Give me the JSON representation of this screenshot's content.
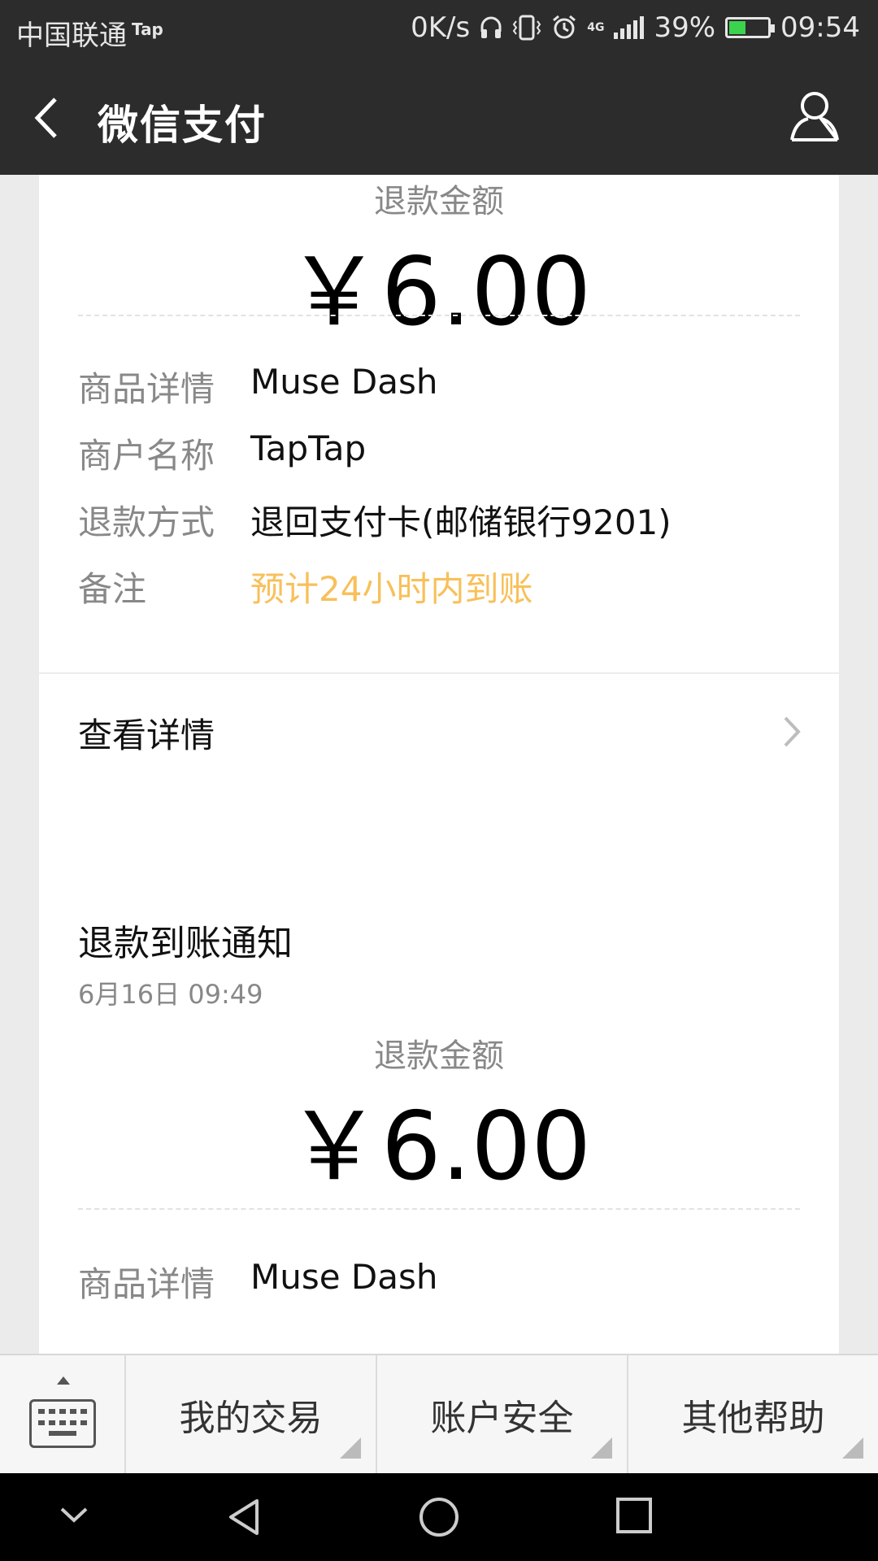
{
  "status_bar": {
    "carrier": "中国联通",
    "carrier_badge": "Tap",
    "speed": "0K/s",
    "network": "4G",
    "battery": "39%",
    "time": "09:54"
  },
  "title_bar": {
    "title": "微信支付",
    "back_icon": "chevron-left-icon",
    "user_icon": "user-icon"
  },
  "refund_card": {
    "amount_label": "退款金额",
    "amount": "￥6.00",
    "rows": [
      {
        "key": "商品详情",
        "value": "Muse Dash"
      },
      {
        "key": "商户名称",
        "value": "TapTap"
      },
      {
        "key": "退款方式",
        "value": "退回支付卡(邮储银行9201)"
      },
      {
        "key": "备注",
        "value": "预计24小时内到账"
      }
    ],
    "details_label": "查看详情"
  },
  "notice_card": {
    "title": "退款到账通知",
    "time": "6月16日  09:49",
    "amount_label": "退款金额",
    "amount": "￥6.00",
    "partial_row": {
      "key": "商品详情",
      "value": "Muse Dash"
    }
  },
  "bottom_menu": {
    "items": [
      "我的交易",
      "账户安全",
      "其他帮助"
    ]
  },
  "colors": {
    "header_bg": "#2c2c2c",
    "page_bg": "#ebebeb",
    "note_orange": "#f8c05a",
    "battery_green": "#3bd24e"
  }
}
